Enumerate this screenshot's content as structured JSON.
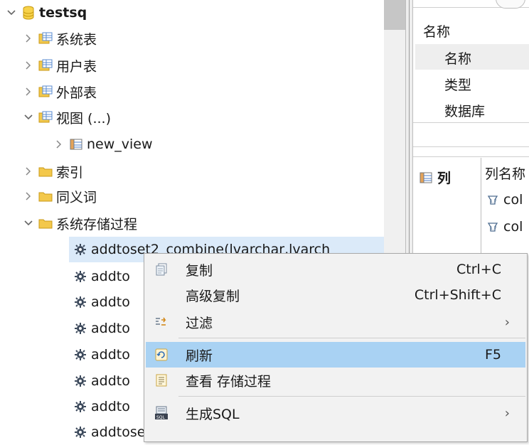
{
  "tree": {
    "root": "testsq",
    "items": [
      {
        "label": "系统表"
      },
      {
        "label": "用户表"
      },
      {
        "label": "外部表"
      },
      {
        "label": "视图 (...)"
      },
      {
        "label": "new_view"
      },
      {
        "label": "索引"
      },
      {
        "label": "同义词"
      },
      {
        "label": "系统存储过程"
      }
    ],
    "procedures": [
      "addtoset2_combine(lvarchar,lvarch",
      "addto",
      "addto",
      "addto",
      "addto",
      "addto",
      "addto",
      "addtoset_iter(lvarchar,bson)"
    ]
  },
  "right_pane": {
    "section_title": "名称",
    "props": [
      "名称",
      "类型",
      "数据库"
    ],
    "columns_tab": "列",
    "column_header": "列名称",
    "columns": [
      "col",
      "col"
    ]
  },
  "context_menu": {
    "items": [
      {
        "label": "复制",
        "shortcut": "Ctrl+C"
      },
      {
        "label": "高级复制",
        "shortcut": "Ctrl+Shift+C"
      },
      {
        "label": "过滤",
        "submenu": "›"
      },
      {
        "label": "刷新",
        "shortcut": "F5"
      },
      {
        "label": "查看 存储过程"
      },
      {
        "label": "生成SQL",
        "submenu": "›"
      }
    ]
  },
  "colors": {
    "selection": "#dbeaf9",
    "menu_hover": "#a9d2f3",
    "menu_bg": "#f2f2f2"
  }
}
